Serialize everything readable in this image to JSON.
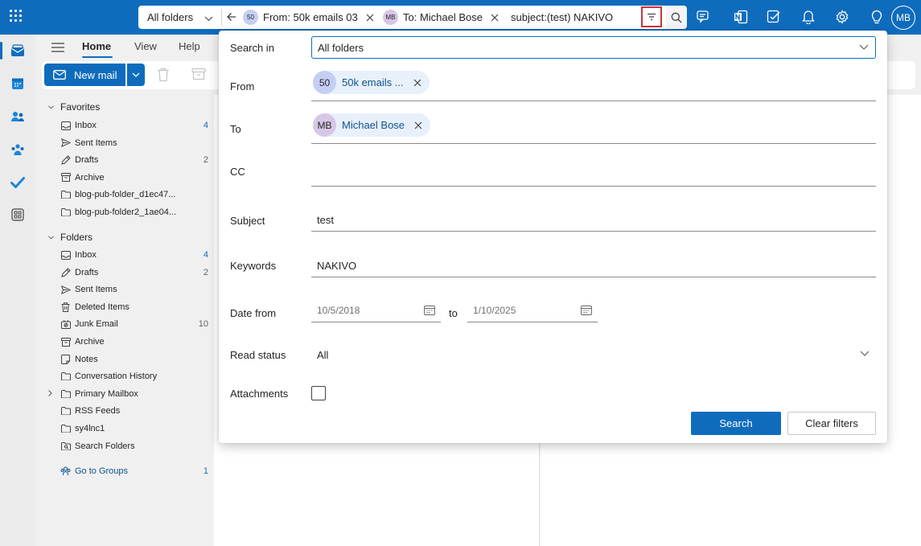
{
  "colors": {
    "brand": "#0f6cbd",
    "highlight_border": "#d13438",
    "chip_bg": "#e8f0fb"
  },
  "searchbar": {
    "folder_scope": "All folders",
    "from_pill": {
      "initials": "50",
      "text": "From: 50k emails 03"
    },
    "to_pill": {
      "initials": "MB",
      "text": "To: Michael Bose"
    },
    "query": "subject:(test) NAKIVO",
    "icons": [
      "back-arrow-icon",
      "filter-icon",
      "search-icon"
    ]
  },
  "header_icons": [
    "chat-icon",
    "onenote-icon",
    "tasks-icon",
    "bell-icon",
    "settings-icon",
    "lightbulb-icon"
  ],
  "user": {
    "initials": "MB"
  },
  "rail_icons": [
    "mail-icon",
    "calendar-icon",
    "people-icon",
    "groups-icon",
    "todo-icon",
    "apps-icon"
  ],
  "ribbon": {
    "tabs": [
      "Home",
      "View",
      "Help"
    ],
    "new_mail": "New mail"
  },
  "nav": {
    "favorites_label": "Favorites",
    "favorites": [
      {
        "label": "Inbox",
        "count": "4",
        "icon": "inbox-icon"
      },
      {
        "label": "Sent Items",
        "count": "",
        "icon": "send-icon"
      },
      {
        "label": "Drafts",
        "count": "2",
        "icon": "draft-icon"
      },
      {
        "label": "Archive",
        "count": "",
        "icon": "archive-icon"
      },
      {
        "label": "blog-pub-folder_d1ec47...",
        "count": "",
        "icon": "folder-icon"
      },
      {
        "label": "blog-pub-folder2_1ae04...",
        "count": "",
        "icon": "folder-icon"
      }
    ],
    "folders_label": "Folders",
    "folders": [
      {
        "label": "Inbox",
        "count": "4",
        "icon": "inbox-icon"
      },
      {
        "label": "Drafts",
        "count": "2",
        "icon": "draft-icon"
      },
      {
        "label": "Sent Items",
        "count": "",
        "icon": "send-icon"
      },
      {
        "label": "Deleted Items",
        "count": "",
        "icon": "trash-icon"
      },
      {
        "label": "Junk Email",
        "count": "10",
        "icon": "junk-icon"
      },
      {
        "label": "Archive",
        "count": "",
        "icon": "archive-icon"
      },
      {
        "label": "Notes",
        "count": "",
        "icon": "note-icon"
      },
      {
        "label": "Conversation History",
        "count": "",
        "icon": "folder-icon"
      },
      {
        "label": "Primary Mailbox",
        "count": "",
        "icon": "folder-icon"
      },
      {
        "label": "RSS Feeds",
        "count": "",
        "icon": "folder-icon"
      },
      {
        "label": "sy4lnc1",
        "count": "",
        "icon": "folder-icon"
      },
      {
        "label": "Search Folders",
        "count": "",
        "icon": "search-folder-icon"
      }
    ],
    "groups_link": {
      "label": "Go to Groups",
      "count": "1"
    }
  },
  "search_panel": {
    "search_in_label": "Search in",
    "search_in_value": "All folders",
    "from_label": "From",
    "from_chip": {
      "initials": "50",
      "name": "50k emails ..."
    },
    "to_label": "To",
    "to_chip": {
      "initials": "MB",
      "name": "Michael Bose"
    },
    "cc_label": "CC",
    "subject_label": "Subject",
    "subject_value": "test",
    "keywords_label": "Keywords",
    "keywords_value": "NAKIVO",
    "date_from_label": "Date from",
    "date_from": "10/5/2018",
    "date_to_label": "to",
    "date_to": "1/10/2025",
    "read_status_label": "Read status",
    "read_status_value": "All",
    "attachments_label": "Attachments",
    "attachments_checked": false,
    "search_button": "Search",
    "clear_button": "Clear filters"
  }
}
